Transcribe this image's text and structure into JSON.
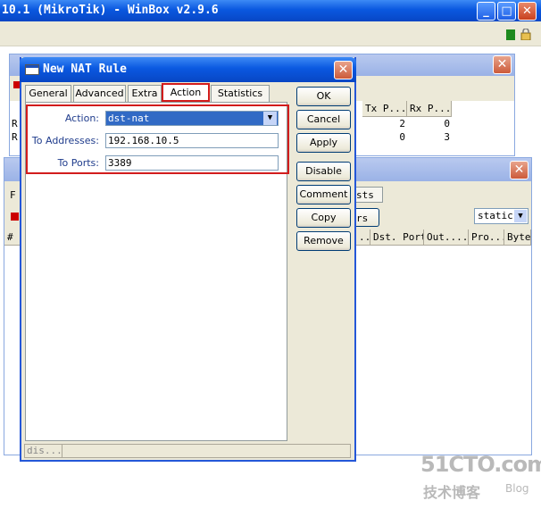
{
  "main_window": {
    "title": "10.1 (MikroTik) - WinBox v2.9.6"
  },
  "top_window": {
    "columns": [
      "Tx P...",
      "Rx P..."
    ],
    "rows": [
      {
        "lead": "R",
        "tx": "2",
        "rx": "0"
      },
      {
        "lead": "R",
        "tx": "0",
        "rx": "3"
      }
    ]
  },
  "nat_window": {
    "frag_f": "F",
    "tab_partial": "sts",
    "button_partial": "rs",
    "filter_value": "static",
    "hash_col": "#",
    "columns": [
      "...",
      "Dst. Port",
      "Out....",
      "Pro...",
      "Byte"
    ]
  },
  "dialog": {
    "title": "New NAT Rule",
    "tabs": [
      "General",
      "Advanced",
      "Extra",
      "Action",
      "Statistics"
    ],
    "active_tab": "Action",
    "fields": {
      "action_label": "Action:",
      "action_value": "dst-nat",
      "to_addresses_label": "To Addresses:",
      "to_addresses_value": "192.168.10.5",
      "to_ports_label": "To Ports:",
      "to_ports_value": "3389"
    },
    "buttons": {
      "ok": "OK",
      "cancel": "Cancel",
      "apply": "Apply",
      "disable": "Disable",
      "comment": "Comment",
      "copy": "Copy",
      "remove": "Remove"
    },
    "status": "dis..."
  },
  "watermark": {
    "main": "51CTO.com",
    "sub": "技术博客",
    "blog": "Blog"
  },
  "colors": {
    "xp_blue": "#0a58e0",
    "highlight_red": "#d21c1c",
    "selection": "#316ac5"
  }
}
